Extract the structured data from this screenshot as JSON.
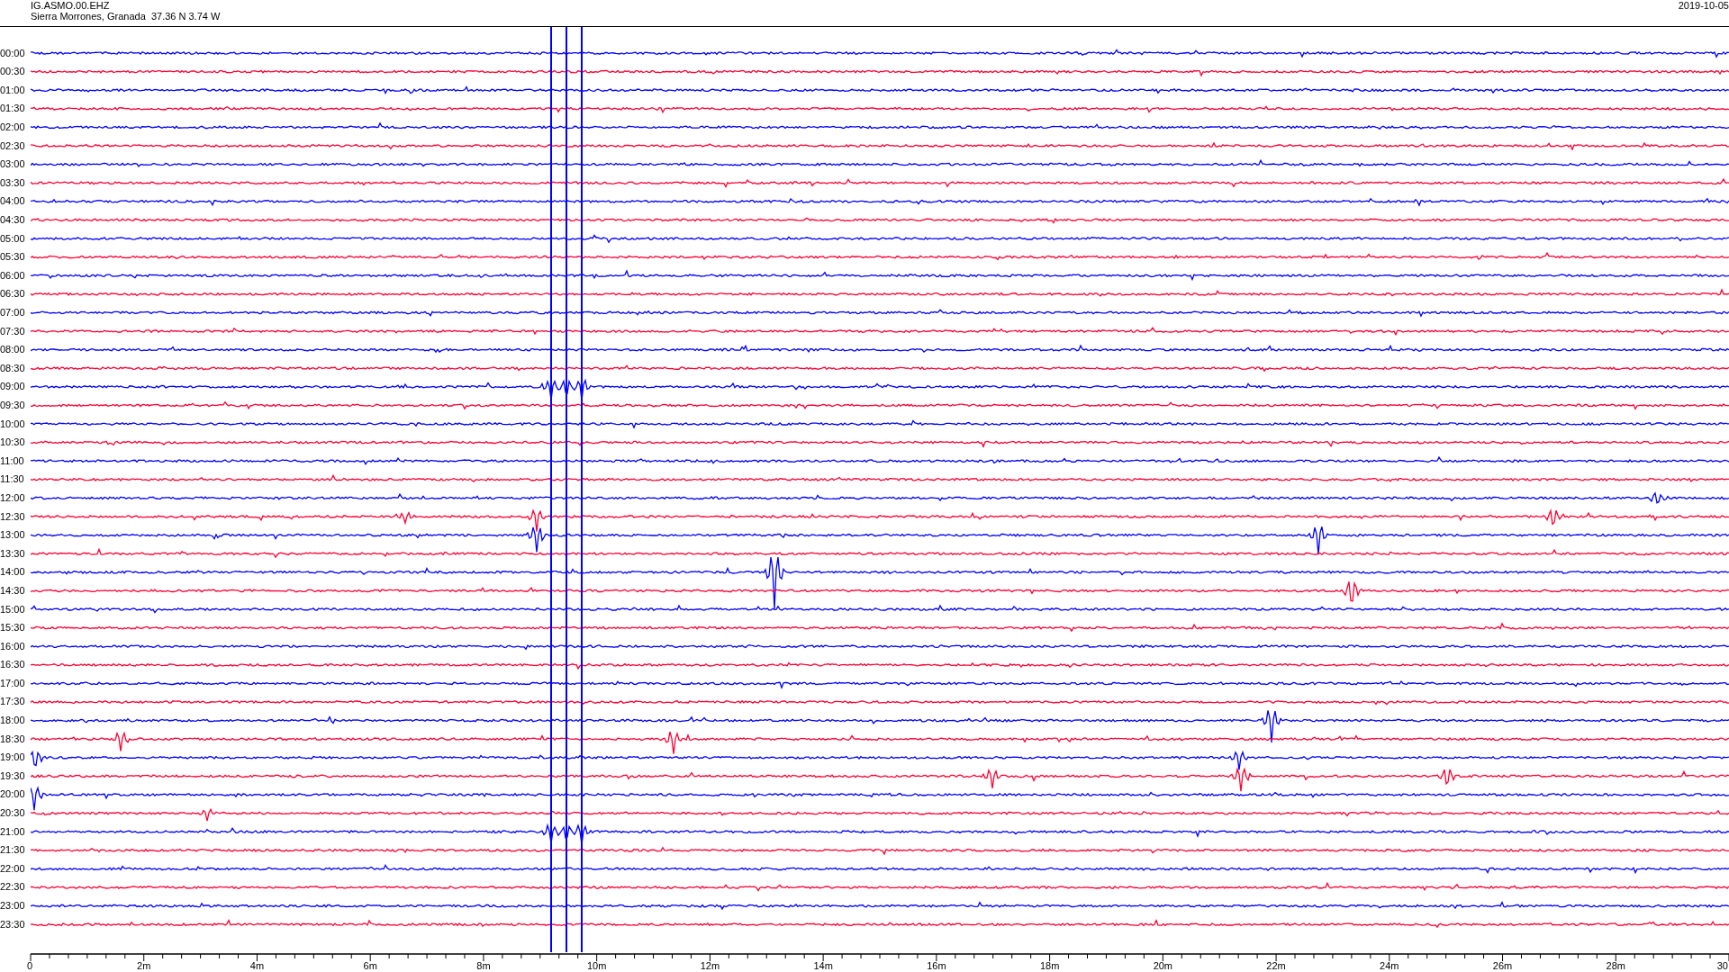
{
  "header": {
    "station": "IG.ASMO.00.EHZ",
    "location": "Sierra Morrones, Granada  37.36 N 3.74 W",
    "date": "2019-10-05"
  },
  "rows": [
    {
      "time": "00:00",
      "color": "#0000ff"
    },
    {
      "time": "00:30",
      "color": "#ff0033"
    },
    {
      "time": "01:00",
      "color": "#0000ff"
    },
    {
      "time": "01:30",
      "color": "#ff0033"
    },
    {
      "time": "02:00",
      "color": "#0000ff"
    },
    {
      "time": "02:30",
      "color": "#ff0033"
    },
    {
      "time": "03:00",
      "color": "#0000ff"
    },
    {
      "time": "03:30",
      "color": "#ff0033"
    },
    {
      "time": "04:00",
      "color": "#0000ff"
    },
    {
      "time": "04:30",
      "color": "#ff0033"
    },
    {
      "time": "05:00",
      "color": "#0000ff"
    },
    {
      "time": "05:30",
      "color": "#ff0033"
    },
    {
      "time": "06:00",
      "color": "#0000ff"
    },
    {
      "time": "06:30",
      "color": "#ff0033"
    },
    {
      "time": "07:00",
      "color": "#0000ff"
    },
    {
      "time": "07:30",
      "color": "#ff0033"
    },
    {
      "time": "08:00",
      "color": "#0000ff"
    },
    {
      "time": "08:30",
      "color": "#ff0033"
    },
    {
      "time": "09:00",
      "color": "#0000ff"
    },
    {
      "time": "09:30",
      "color": "#ff0033"
    },
    {
      "time": "10:00",
      "color": "#0000ff"
    },
    {
      "time": "10:30",
      "color": "#ff0033"
    },
    {
      "time": "11:00",
      "color": "#0000ff"
    },
    {
      "time": "11:30",
      "color": "#ff0033"
    },
    {
      "time": "12:00",
      "color": "#0000ff"
    },
    {
      "time": "12:30",
      "color": "#ff0033"
    },
    {
      "time": "13:00",
      "color": "#0000ff"
    },
    {
      "time": "13:30",
      "color": "#ff0033"
    },
    {
      "time": "14:00",
      "color": "#0000ff"
    },
    {
      "time": "14:30",
      "color": "#ff0033"
    },
    {
      "time": "15:00",
      "color": "#0000ff"
    },
    {
      "time": "15:30",
      "color": "#ff0033"
    },
    {
      "time": "16:00",
      "color": "#0000ff"
    },
    {
      "time": "16:30",
      "color": "#ff0033"
    },
    {
      "time": "17:00",
      "color": "#0000ff"
    },
    {
      "time": "17:30",
      "color": "#ff0033"
    },
    {
      "time": "18:00",
      "color": "#0000ff"
    },
    {
      "time": "18:30",
      "color": "#ff0033"
    },
    {
      "time": "19:00",
      "color": "#0000ff"
    },
    {
      "time": "19:30",
      "color": "#ff0033"
    },
    {
      "time": "20:00",
      "color": "#0000ff"
    },
    {
      "time": "20:30",
      "color": "#ff0033"
    },
    {
      "time": "21:00",
      "color": "#0000ff"
    },
    {
      "time": "21:30",
      "color": "#ff0033"
    },
    {
      "time": "22:00",
      "color": "#0000ff"
    },
    {
      "time": "22:30",
      "color": "#ff0033"
    },
    {
      "time": "23:00",
      "color": "#0000ff"
    },
    {
      "time": "23:30",
      "color": "#ff0033"
    }
  ],
  "x_axis": {
    "ticks": [
      "0",
      "2m",
      "4m",
      "6m",
      "8m",
      "10m",
      "12m",
      "14m",
      "16m",
      "18m",
      "20m",
      "22m",
      "24m",
      "26m",
      "28m",
      "30"
    ]
  }
}
